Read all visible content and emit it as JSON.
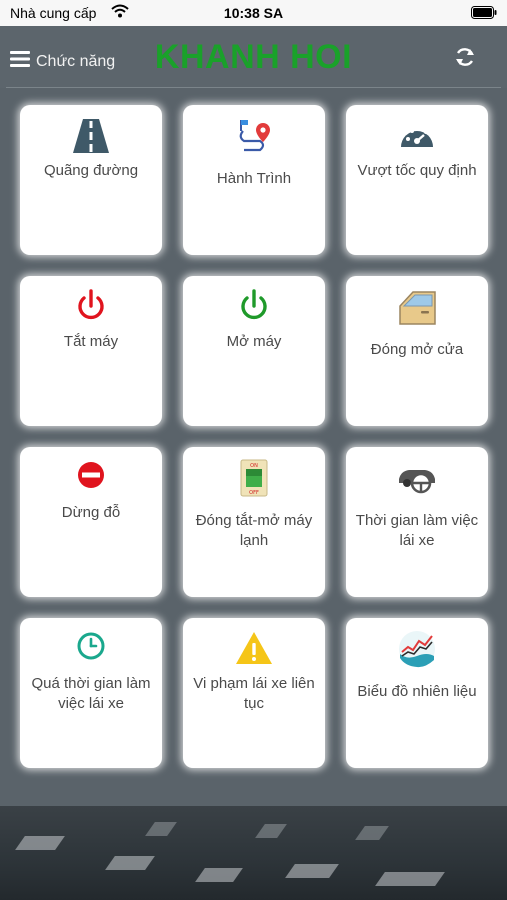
{
  "status_bar": {
    "carrier": "Nhà cung cấp",
    "time": "10:38 SA"
  },
  "header": {
    "menu_title": "Chức năng",
    "brand": "KHANH HOI",
    "brand_color": "#1aa12a"
  },
  "tiles": [
    {
      "label": "Quãng đường",
      "icon": "road-icon"
    },
    {
      "label": "Hành Trình",
      "icon": "route-pin-icon"
    },
    {
      "label": "Vượt tốc quy định",
      "icon": "speedometer-icon"
    },
    {
      "label": "Tắt máy",
      "icon": "power-off-icon",
      "color": "#e0141e"
    },
    {
      "label": "Mở máy",
      "icon": "power-on-icon",
      "color": "#1f9a2a"
    },
    {
      "label": "Đóng mở cửa",
      "icon": "car-door-icon"
    },
    {
      "label": "Dừng đỗ",
      "icon": "no-entry-icon",
      "color": "#e0141e"
    },
    {
      "label": "Đóng tắt-mở máy lạnh",
      "icon": "on-off-switch-icon"
    },
    {
      "label": "Thời gian làm việc lái xe",
      "icon": "car-wheel-icon"
    },
    {
      "label": "Quá thời gian làm việc lái xe",
      "icon": "clock-icon",
      "color": "#1aa88d"
    },
    {
      "label": "Vi phạm lái xe liên tục",
      "icon": "warning-icon",
      "color": "#f5c518"
    },
    {
      "label": "Biểu đồ nhiên liệu",
      "icon": "fuel-chart-icon"
    }
  ]
}
